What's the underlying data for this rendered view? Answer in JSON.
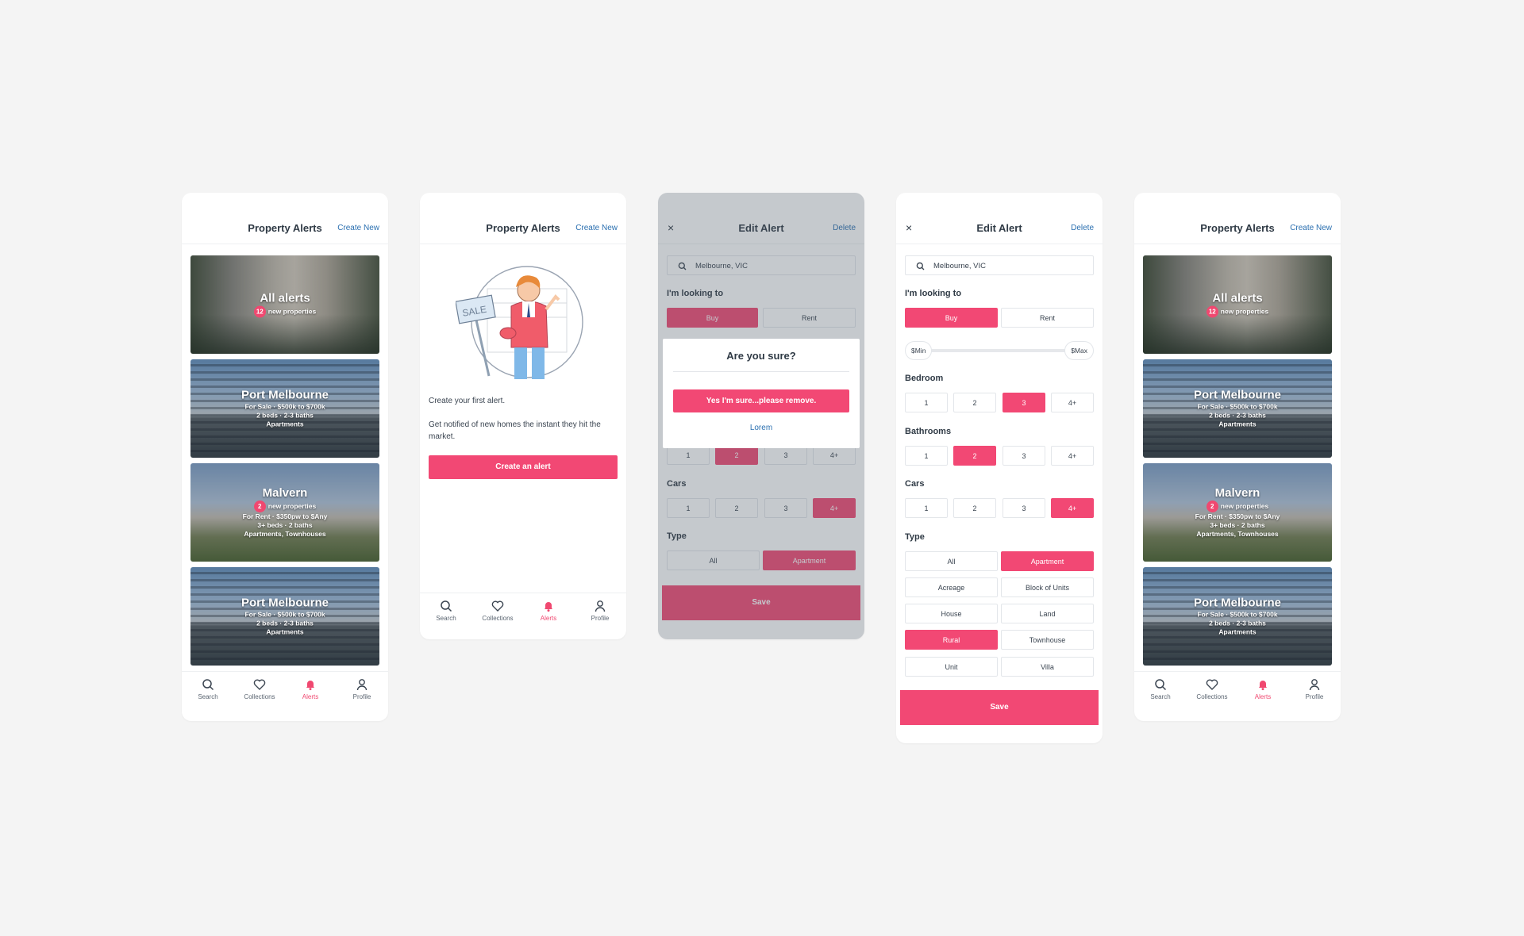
{
  "colors": {
    "accent": "#f24874",
    "link": "#2a6fb0",
    "background": "#f4f4f4"
  },
  "list_screen": {
    "title": "Property Alerts",
    "action": "Create New",
    "cards": [
      {
        "headline": "All alerts",
        "badge": "12",
        "badge_text": "new properties",
        "lines": []
      },
      {
        "headline": "Port Melbourne",
        "badge": "",
        "badge_text": "",
        "lines": [
          "For Sale · $500k to $700k",
          "2 beds · 2-3 baths",
          "Apartments"
        ]
      },
      {
        "headline": "Malvern",
        "badge": "2",
        "badge_text": "new properties",
        "lines": [
          "For Rent · $350pw to $Any",
          "3+ beds · 2 baths",
          "Apartments, Townhouses"
        ]
      },
      {
        "headline": "Port Melbourne",
        "badge": "",
        "badge_text": "",
        "lines": [
          "For Sale · $500k to $700k",
          "2 beds · 2-3 baths",
          "Apartments"
        ]
      }
    ]
  },
  "nav": {
    "search": "Search",
    "search_icon": "search-icon",
    "collections": "Collections",
    "collections_icon": "heart-icon",
    "alerts": "Alerts",
    "alerts_icon": "bell-icon",
    "profile": "Profile",
    "profile_icon": "user-icon"
  },
  "empty_screen": {
    "title": "Property Alerts",
    "action": "Create New",
    "sign_text": "SALE",
    "line1": "Create your first alert.",
    "line2": "Get notified of new homes the instant they hit the market.",
    "button": "Create an alert"
  },
  "edit_screen": {
    "close": "×",
    "title": "Edit Alert",
    "delete": "Delete",
    "location": "Melbourne, VIC",
    "looking_to_label": "I'm looking to",
    "buy": "Buy",
    "rent": "Rent",
    "price_min": "$Min",
    "price_max": "$Max",
    "bedroom_label": "Bedroom",
    "bathrooms_label": "Bathrooms",
    "cars_label": "Cars",
    "type_label": "Type",
    "counts": [
      "1",
      "2",
      "3",
      "4+"
    ],
    "types": [
      "All",
      "Apartment",
      "Acreage",
      "Block of Units",
      "House",
      "Land",
      "Rural",
      "Townhouse",
      "Unit",
      "Villa"
    ],
    "save": "Save"
  },
  "confirm_dialog": {
    "title": "Are you sure?",
    "confirm": "Yes I'm sure...please remove.",
    "cancel": "Lorem"
  }
}
